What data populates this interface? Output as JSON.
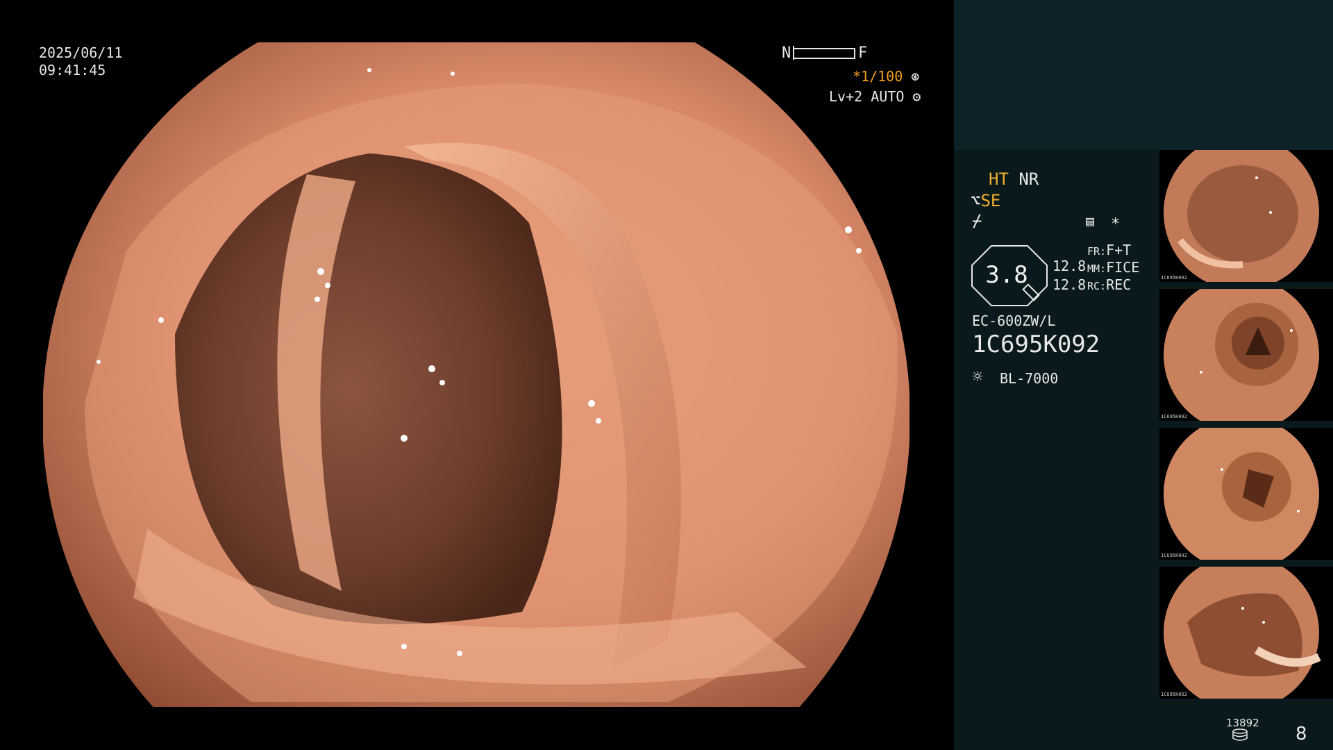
{
  "osd": {
    "date": "2025/06/11",
    "time": "09:41:45",
    "nf_near": "N",
    "nf_far": "F",
    "shutter": "*1/100",
    "level": "Lv+2 AUTO"
  },
  "info": {
    "ht": "HT",
    "nr": "NR",
    "se": "SE",
    "zoom": "3.8",
    "mode_value_1": "12.8",
    "mode_value_2": "12.8",
    "fr_label": "FR:",
    "fr_value": "F+T",
    "mm_label": "MM:",
    "mm_value": "FICE",
    "rc_label": "RC:",
    "rc_value": "REC",
    "scope_model": "EC-600ZW/L",
    "serial": "1C695K092",
    "light_source": "BL-7000"
  },
  "storage": {
    "counter": "13892",
    "page": "8"
  },
  "thumbnails": [
    {
      "caption": "1C695K092"
    },
    {
      "caption": "1C695K092"
    },
    {
      "caption": "1C695K092"
    },
    {
      "caption": "1C695K092"
    }
  ],
  "colors": {
    "osd_amber": "#f0b030",
    "panel_bg": "#0a1a1c",
    "panel_top_bg": "#0c2226",
    "tissue": "#d98a6a"
  },
  "icons": {
    "shutter": "aperture-icon",
    "level": "gear-icon",
    "se": "enhance-icon",
    "adjust": "flash-icon",
    "document": "document-icon",
    "star": "asterisk-icon",
    "light": "sun-icon",
    "storage": "database-icon"
  }
}
